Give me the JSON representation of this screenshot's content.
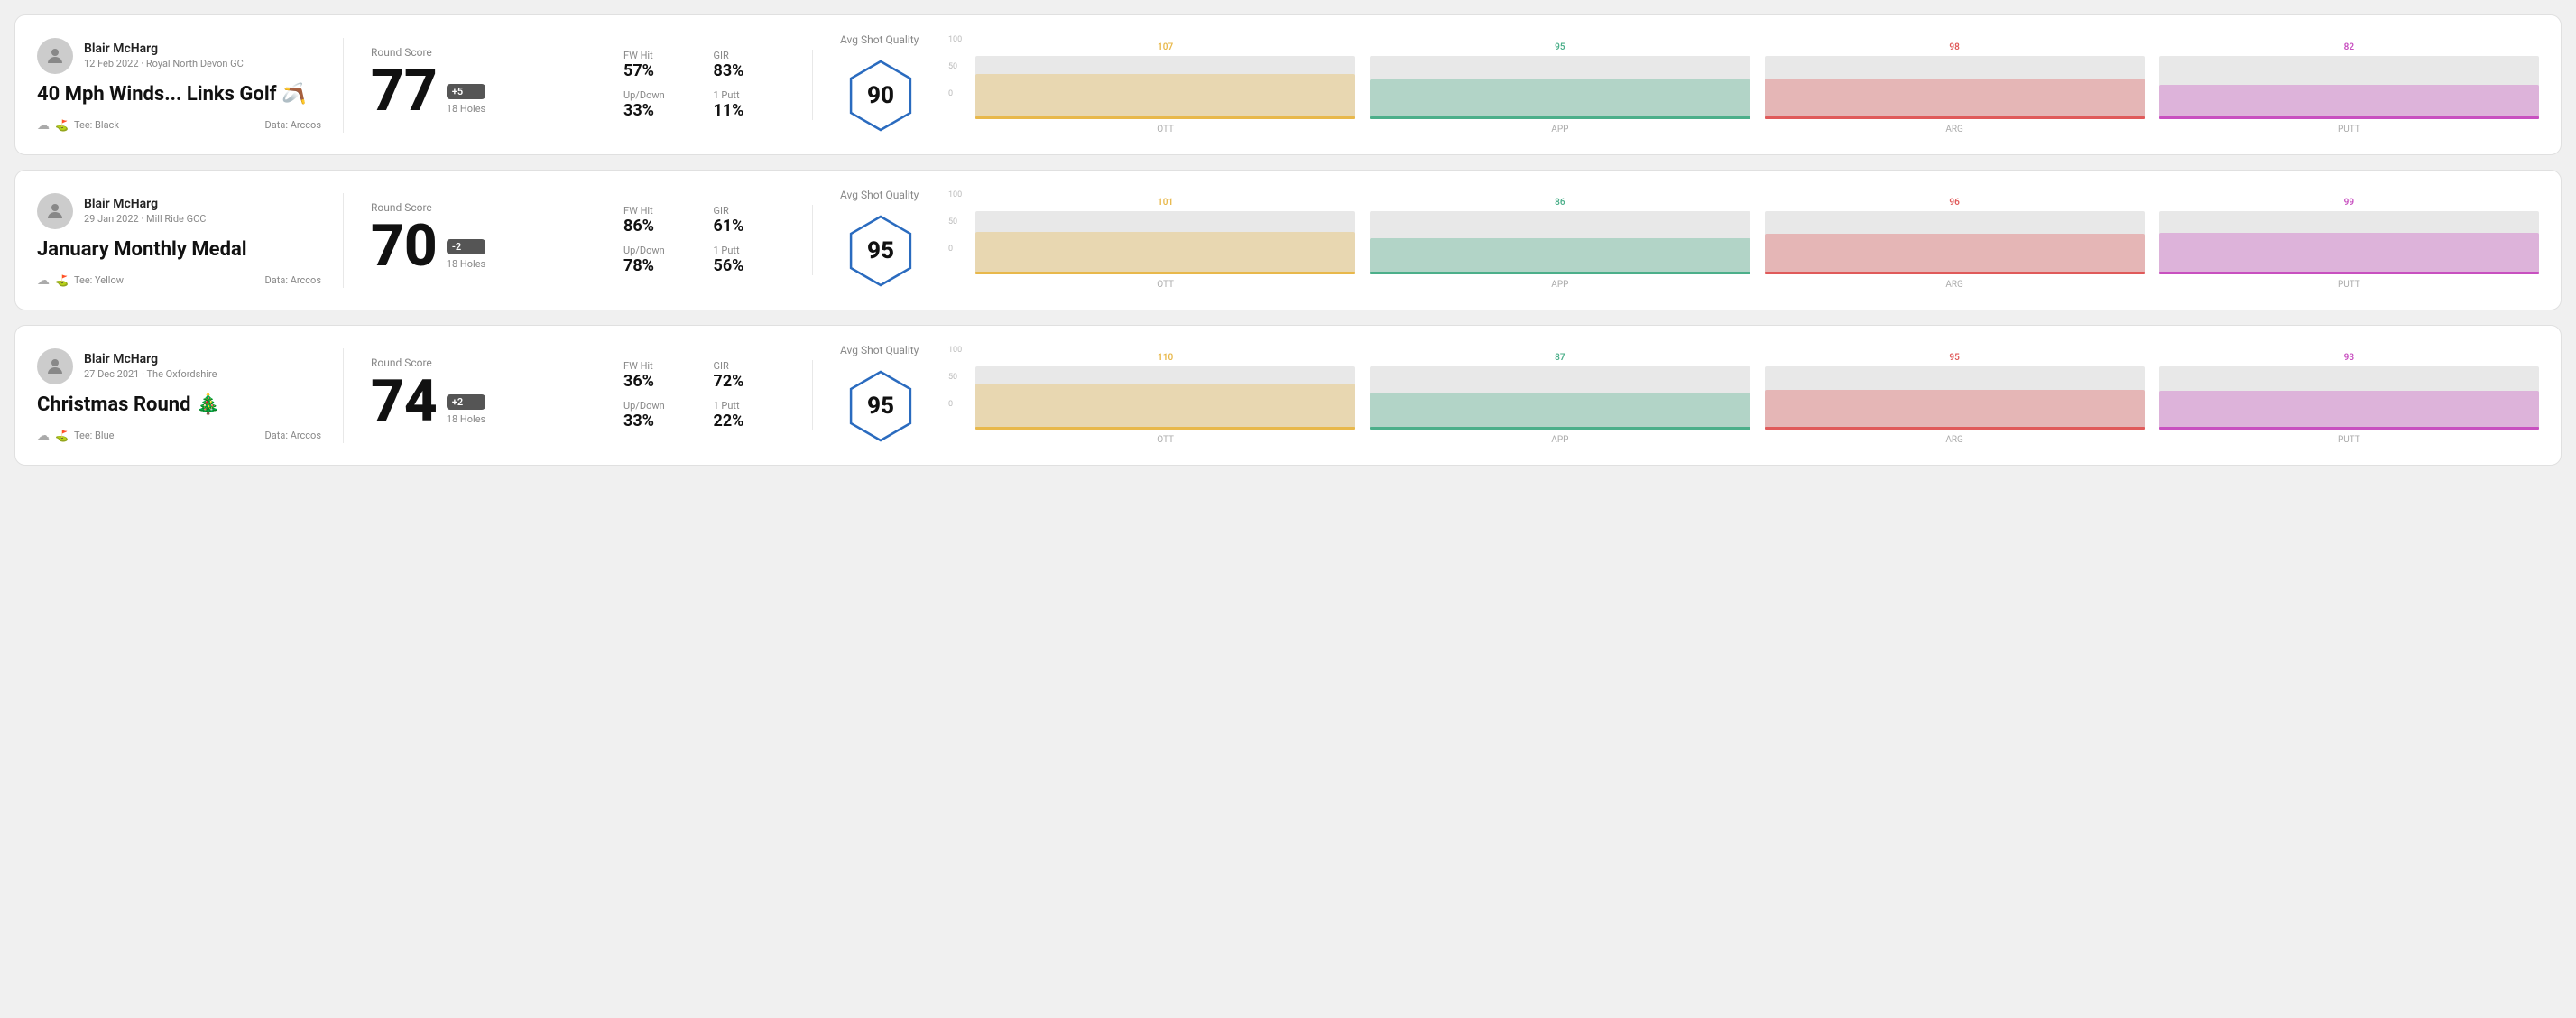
{
  "rounds": [
    {
      "id": "round1",
      "user": {
        "name": "Blair McHarg",
        "date": "12 Feb 2022",
        "venue": "Royal North Devon GC"
      },
      "title": "40 Mph Winds... Links Golf 🪃",
      "tee": "Black",
      "data_source": "Data: Arccos",
      "round_score_label": "Round Score",
      "score": "77",
      "score_badge": "+5",
      "holes": "18 Holes",
      "fw_hit_label": "FW Hit",
      "fw_hit": "57%",
      "gir_label": "GIR",
      "gir": "83%",
      "updown_label": "Up/Down",
      "updown": "33%",
      "one_putt_label": "1 Putt",
      "one_putt": "11%",
      "avg_shot_quality_label": "Avg Shot Quality",
      "hex_score": "90",
      "chart": {
        "ott": {
          "value": 107,
          "color": "#e8b84b",
          "fill_pct": 71
        },
        "app": {
          "value": 95,
          "color": "#4caf8a",
          "fill_pct": 63
        },
        "arg": {
          "value": 98,
          "color": "#e05a5a",
          "fill_pct": 65
        },
        "putt": {
          "value": 82,
          "color": "#c850c0",
          "fill_pct": 55
        }
      }
    },
    {
      "id": "round2",
      "user": {
        "name": "Blair McHarg",
        "date": "29 Jan 2022",
        "venue": "Mill Ride GCC"
      },
      "title": "January Monthly Medal",
      "tee": "Yellow",
      "data_source": "Data: Arccos",
      "round_score_label": "Round Score",
      "score": "70",
      "score_badge": "-2",
      "holes": "18 Holes",
      "fw_hit_label": "FW Hit",
      "fw_hit": "86%",
      "gir_label": "GIR",
      "gir": "61%",
      "updown_label": "Up/Down",
      "updown": "78%",
      "one_putt_label": "1 Putt",
      "one_putt": "56%",
      "avg_shot_quality_label": "Avg Shot Quality",
      "hex_score": "95",
      "chart": {
        "ott": {
          "value": 101,
          "color": "#e8b84b",
          "fill_pct": 67
        },
        "app": {
          "value": 86,
          "color": "#4caf8a",
          "fill_pct": 57
        },
        "arg": {
          "value": 96,
          "color": "#e05a5a",
          "fill_pct": 64
        },
        "putt": {
          "value": 99,
          "color": "#c850c0",
          "fill_pct": 66
        }
      }
    },
    {
      "id": "round3",
      "user": {
        "name": "Blair McHarg",
        "date": "27 Dec 2021",
        "venue": "The Oxfordshire"
      },
      "title": "Christmas Round 🎄",
      "tee": "Blue",
      "data_source": "Data: Arccos",
      "round_score_label": "Round Score",
      "score": "74",
      "score_badge": "+2",
      "holes": "18 Holes",
      "fw_hit_label": "FW Hit",
      "fw_hit": "36%",
      "gir_label": "GIR",
      "gir": "72%",
      "updown_label": "Up/Down",
      "updown": "33%",
      "one_putt_label": "1 Putt",
      "one_putt": "22%",
      "avg_shot_quality_label": "Avg Shot Quality",
      "hex_score": "95",
      "chart": {
        "ott": {
          "value": 110,
          "color": "#e8b84b",
          "fill_pct": 73
        },
        "app": {
          "value": 87,
          "color": "#4caf8a",
          "fill_pct": 58
        },
        "arg": {
          "value": 95,
          "color": "#e05a5a",
          "fill_pct": 63
        },
        "putt": {
          "value": 93,
          "color": "#c850c0",
          "fill_pct": 62
        }
      }
    }
  ],
  "chart_y_labels": [
    "100",
    "50",
    "0"
  ],
  "chart_x_labels": [
    "OTT",
    "APP",
    "ARG",
    "PUTT"
  ]
}
